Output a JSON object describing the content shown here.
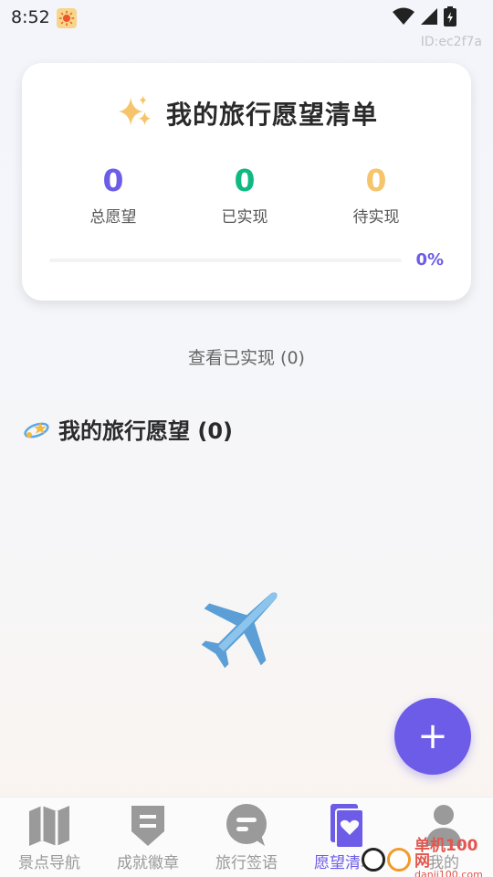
{
  "status_bar": {
    "time": "8:52",
    "icons": [
      "weather-sun-icon",
      "wifi-icon",
      "signal-icon",
      "battery-icon"
    ]
  },
  "device_id": "ID:ec2f7a",
  "summary": {
    "title": "我的旅行愿望清单",
    "stats": [
      {
        "value": "0",
        "label": "总愿望",
        "color": "#6c5ce7"
      },
      {
        "value": "0",
        "label": "已实现",
        "color": "#10b981"
      },
      {
        "value": "0",
        "label": "待实现",
        "color": "#f5c46b"
      }
    ],
    "progress_text": "0%",
    "progress": 0
  },
  "view_achieved": "查看已实现 (0)",
  "section": {
    "title": "我的旅行愿望 (0)"
  },
  "fab_label": "+",
  "nav": [
    {
      "label": "景点导航",
      "icon": "map-icon",
      "active": false
    },
    {
      "label": "成就徽章",
      "icon": "badge-icon",
      "active": false
    },
    {
      "label": "旅行签语",
      "icon": "chat-bubble-icon",
      "active": false
    },
    {
      "label": "愿望清单",
      "icon": "wishlist-icon",
      "active": true
    },
    {
      "label": "我的",
      "icon": "person-icon",
      "active": false
    }
  ],
  "watermark": {
    "brand": "单机100网",
    "url": "danji100.com"
  },
  "colors": {
    "accent": "#6c5ce7",
    "success": "#10b981",
    "pending": "#f5c46b"
  }
}
